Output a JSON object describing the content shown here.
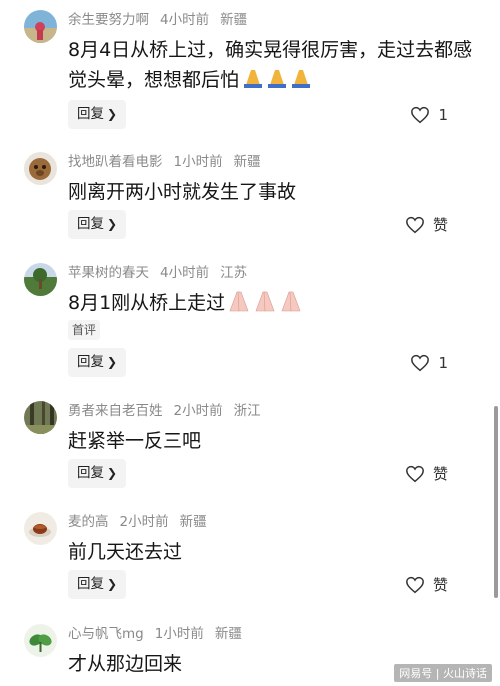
{
  "comments": [
    {
      "username": "余生要努力啊",
      "time": "4小时前",
      "location": "新疆",
      "text": "8月4日从桥上过，确实晃得很厉害，走过去都感觉头晕，想想都后怕",
      "emoji": "praying-hands x3",
      "tag": "",
      "reply_label": "回复",
      "like_label": "1"
    },
    {
      "username": "找地趴着看电影",
      "time": "1小时前",
      "location": "新疆",
      "text": "刚离开两小时就发生了事故",
      "tag": "",
      "reply_label": "回复",
      "like_label": "赞"
    },
    {
      "username": "苹果树的春天",
      "time": "4小时前",
      "location": "江苏",
      "text": "8月1刚从桥上走过",
      "emoji": "praying-hands x3",
      "tag": "首评",
      "reply_label": "回复",
      "like_label": "1"
    },
    {
      "username": "勇者来自老百姓",
      "time": "2小时前",
      "location": "浙江",
      "text": "赶紧举一反三吧",
      "tag": "",
      "reply_label": "回复",
      "like_label": "赞"
    },
    {
      "username": "麦的高",
      "time": "2小时前",
      "location": "新疆",
      "text": "前几天还去过",
      "tag": "",
      "reply_label": "回复",
      "like_label": "赞"
    },
    {
      "username": "心与帆飞mg",
      "time": "1小时前",
      "location": "新疆",
      "text": "才从那边回来",
      "tag": "",
      "reply_label": "回复",
      "like_label": ""
    }
  ],
  "watermark": "网易号 | 火山诗话"
}
